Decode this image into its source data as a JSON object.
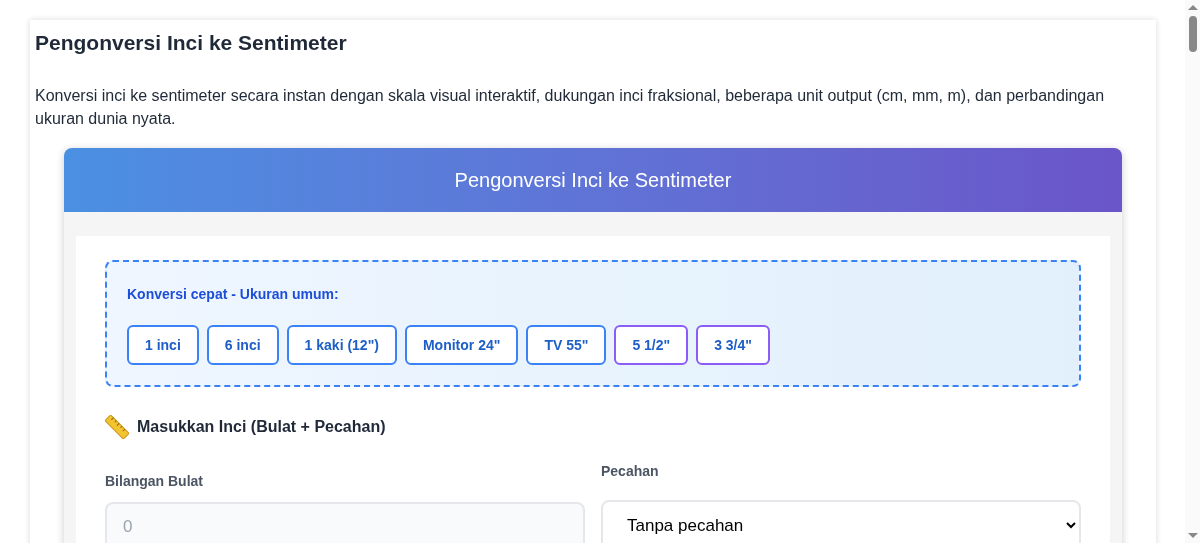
{
  "page": {
    "title": "Pengonversi Inci ke Sentimeter",
    "description": "Konversi inci ke sentimeter secara instan dengan skala visual interaktif, dukungan inci fraksional, beberapa unit output (cm, mm, m), dan perbandingan ukuran dunia nyata."
  },
  "converter": {
    "header": "Pengonversi Inci ke Sentimeter",
    "quick": {
      "label": "Konversi cepat - Ukuran umum:",
      "buttons": [
        {
          "label": "1 inci",
          "kind": "common"
        },
        {
          "label": "6 inci",
          "kind": "common"
        },
        {
          "label": "1 kaki (12\")",
          "kind": "common"
        },
        {
          "label": "Monitor 24\"",
          "kind": "common"
        },
        {
          "label": "TV 55\"",
          "kind": "common"
        },
        {
          "label": "5 1/2\"",
          "kind": "fraction"
        },
        {
          "label": "3 3/4\"",
          "kind": "fraction"
        }
      ]
    },
    "input_section": {
      "heading": "Masukkan Inci (Bulat + Pecahan)",
      "whole": {
        "label": "Bilangan Bulat",
        "placeholder": "0"
      },
      "fraction": {
        "label": "Pecahan",
        "value": "Tanpa pecahan"
      }
    }
  }
}
